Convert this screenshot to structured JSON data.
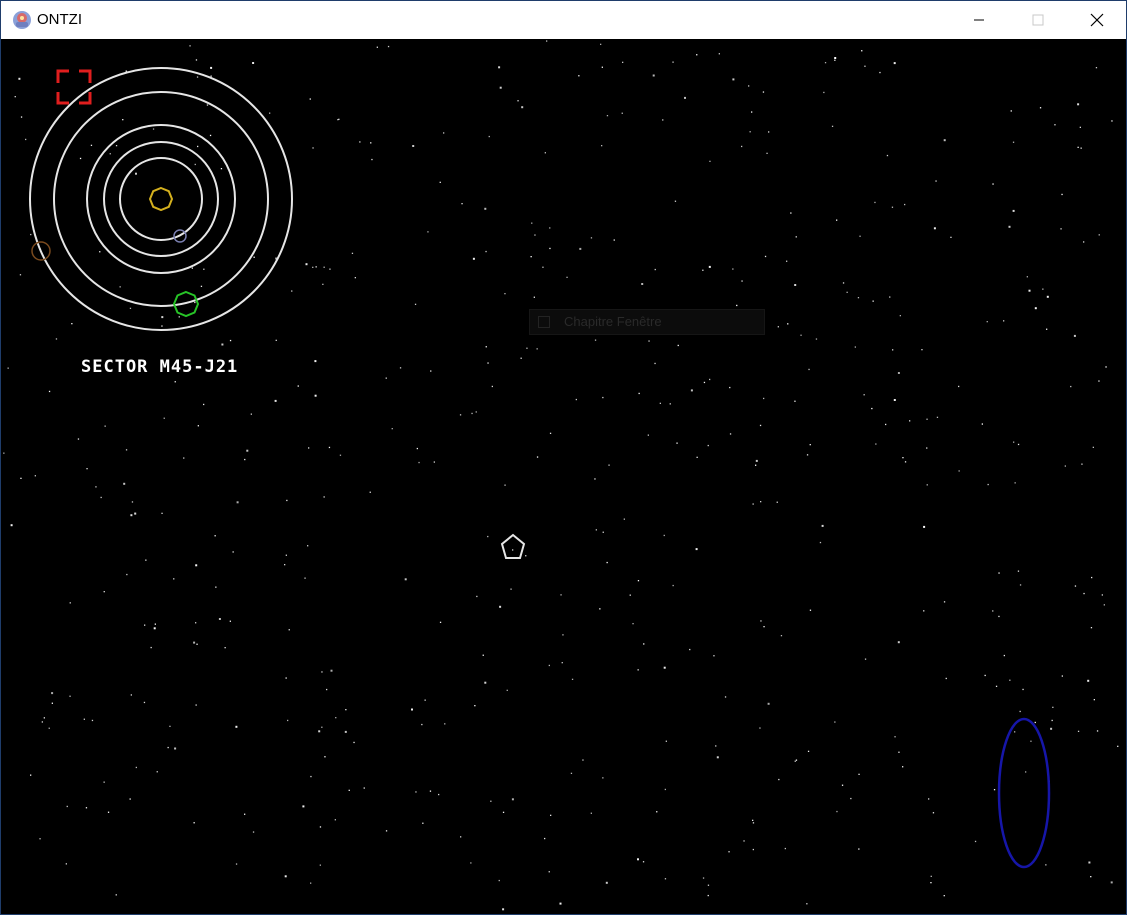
{
  "window": {
    "title": "ONTZI",
    "icon": "game-app-icon",
    "controls": [
      "minimize-icon",
      "maximize-icon",
      "close-icon"
    ]
  },
  "hud": {
    "sector_label": "SECTOR M45-J21",
    "target_bracket_icon": "target-bracket-icon",
    "colors": {
      "target_bracket": "#e01e1e",
      "orbit_ring": "#e6e6e6",
      "sun": "#d4b01e",
      "planet_blue": "#7a7fb0",
      "planet_brown": "#7a4a1e",
      "planet_green": "#27c427",
      "player_ship": "#e6e6e6",
      "portal": "#1616a8"
    }
  },
  "tooltip": {
    "icon": "tooltip-icon",
    "text": "Chapitre Fenêtre"
  }
}
